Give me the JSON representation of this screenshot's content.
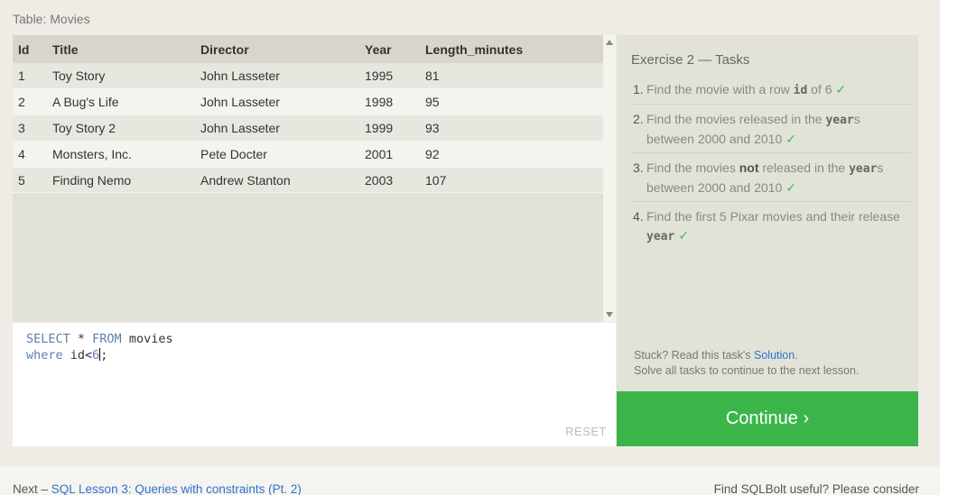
{
  "table_caption": "Table: Movies",
  "table": {
    "headers": [
      "Id",
      "Title",
      "Director",
      "Year",
      "Length_minutes"
    ],
    "rows": [
      [
        "1",
        "Toy Story",
        "John Lasseter",
        "1995",
        "81"
      ],
      [
        "2",
        "A Bug's Life",
        "John Lasseter",
        "1998",
        "95"
      ],
      [
        "3",
        "Toy Story 2",
        "John Lasseter",
        "1999",
        "93"
      ],
      [
        "4",
        "Monsters, Inc.",
        "Pete Docter",
        "2001",
        "92"
      ],
      [
        "5",
        "Finding Nemo",
        "Andrew Stanton",
        "2003",
        "107"
      ]
    ]
  },
  "editor": {
    "line1_kw1": "SELECT",
    "line1_mid": " * ",
    "line1_kw2": "FROM",
    "line1_rest": " movies",
    "line2_kw": "where",
    "line2_mid": " id<",
    "line2_num": "6",
    "line2_end": ";",
    "reset_label": "RESET"
  },
  "tasks": {
    "title": "Exercise 2 — Tasks",
    "items": [
      {
        "num": "1.",
        "parts": [
          "Find the movie with a row ",
          "id",
          " of 6"
        ]
      },
      {
        "num": "2.",
        "parts": [
          "Find the movies released in the ",
          "year",
          "s between 2000 and 2010"
        ]
      },
      {
        "num": "3.",
        "parts": [
          "Find the movies ",
          "not",
          " released in the ",
          "year",
          "s between 2000 and 2010"
        ]
      },
      {
        "num": "4.",
        "parts": [
          "Find the first 5 Pixar movies and their release ",
          "year"
        ]
      }
    ],
    "check": "✓",
    "help_prefix": "Stuck? Read this task's ",
    "help_link": "Solution",
    "help_suffix": ".",
    "help_line2": "Solve all tasks to continue to the next lesson."
  },
  "continue_label": "Continue ›",
  "footer": {
    "next_prefix": "Next – ",
    "next_link": "SQL Lesson 3: Queries with constraints (Pt. 2)",
    "right_text": "Find SQLBolt useful? Please consider"
  },
  "colors": {
    "accent_green": "#3bb54a",
    "link_blue": "#2f72c9",
    "check_green": "#3dbb4d"
  },
  "icons": {
    "scroll_up": "scroll-up-arrow-icon",
    "scroll_down": "scroll-down-arrow-icon",
    "check": "checkmark-icon"
  }
}
